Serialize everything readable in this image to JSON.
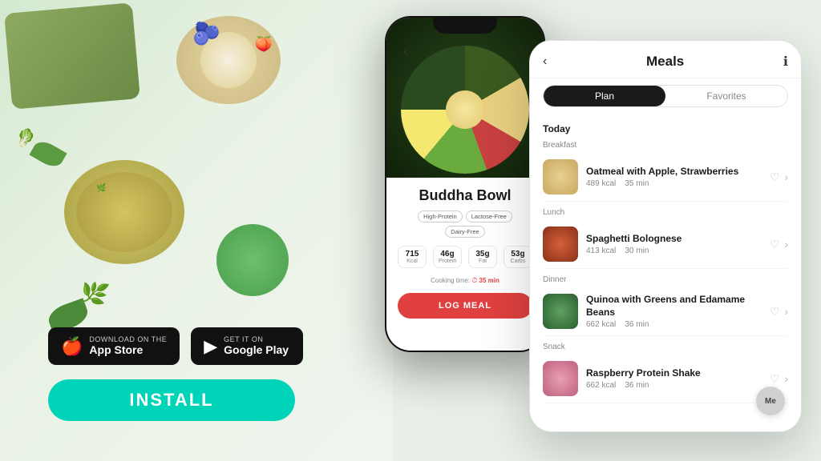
{
  "background": {
    "color": "#e8f0e4"
  },
  "appstore": {
    "label_small": "Download on the",
    "label_large": "App Store",
    "icon": "🍎"
  },
  "googleplay": {
    "label_small": "GET IT ON",
    "label_large": "Google Play"
  },
  "install_button": {
    "label": "INSTALL"
  },
  "phone_left": {
    "meal_name": "Buddha Bowl",
    "tags": [
      "High-Protein",
      "Lactose-Free",
      "Dairy-Free"
    ],
    "stats": [
      {
        "value": "715",
        "label": "Kcal"
      },
      {
        "value": "46g",
        "label": "Protein"
      },
      {
        "value": "35g",
        "label": "Fat"
      },
      {
        "value": "53g",
        "label": "Carbs"
      }
    ],
    "cooking_time_label": "Cooking time:",
    "cooking_time": "35 min",
    "log_meal_label": "LOG MEAL"
  },
  "phone_right": {
    "title": "Meals",
    "tabs": [
      {
        "label": "Plan",
        "active": true
      },
      {
        "label": "Favorites",
        "active": false
      }
    ],
    "section_today": "Today",
    "meals": [
      {
        "type": "Breakfast",
        "name": "Oatmeal with Apple, Strawberries",
        "kcal": "489 kcal",
        "time": "35 min",
        "thumb_class": "meal-thumb-oatmeal"
      },
      {
        "type": "Lunch",
        "name": "Spaghetti Bolognese",
        "kcal": "413 kcal",
        "time": "30 min",
        "thumb_class": "meal-thumb-spaghetti"
      },
      {
        "type": "Dinner",
        "name": "Quinoa with Greens and Edamame Beans",
        "kcal": "662 kcal",
        "time": "36 min",
        "thumb_class": "meal-thumb-quinoa"
      },
      {
        "type": "Snack",
        "name": "Raspberry Protein Shake",
        "kcal": "662 kcal",
        "time": "36 min",
        "thumb_class": "meal-thumb-shake"
      }
    ],
    "avatar_label": "Me"
  }
}
